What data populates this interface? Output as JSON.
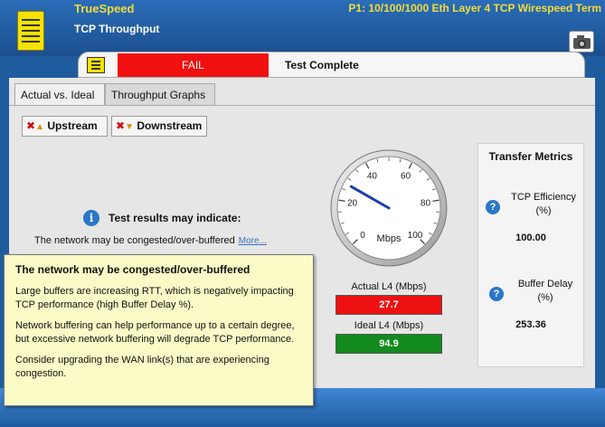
{
  "header": {
    "app_name": "TrueSpeed",
    "test_name": "TCP Throughput",
    "port_info": "P1: 10/100/1000 Eth Layer 4 TCP Wirespeed Term",
    "menu_icon": "menu-icon",
    "camera_icon": "camera-icon"
  },
  "status": {
    "result": "FAIL",
    "result_color": "#f01010",
    "text": "Test Complete"
  },
  "tabs": [
    {
      "label": "Actual vs. Ideal",
      "active": true
    },
    {
      "label": "Throughput Graphs",
      "active": false
    }
  ],
  "direction_buttons": {
    "upstream": "Upstream",
    "downstream": "Downstream"
  },
  "indication": {
    "title": "Test results may indicate:",
    "cause": "The network may be congested/over-buffered",
    "more_link": "More..."
  },
  "gauge": {
    "unit": "Mbps",
    "min": 0,
    "max": 100,
    "ticks": [
      "0",
      "20",
      "40",
      "60",
      "80",
      "100"
    ],
    "needle_value": 27.7
  },
  "actual": {
    "label": "Actual L4 (Mbps)",
    "value": "27.7",
    "color": "#ee1111"
  },
  "ideal": {
    "label": "Ideal L4 (Mbps)",
    "value": "94.9",
    "color": "#128a1e"
  },
  "metrics": {
    "title": "Transfer Metrics",
    "tcp_efficiency": {
      "name_line1": "TCP Efficiency",
      "name_line2": "(%)",
      "value": "100.00"
    },
    "buffer_delay": {
      "name_line1": "Buffer Delay",
      "name_line2": "(%)",
      "value": "253.36"
    }
  },
  "tooltip": {
    "title": "The network may be congested/over-buffered",
    "para1": "Large buffers are increasing RTT, which is negatively impacting TCP performance (high Buffer Delay %).",
    "para2": "Network buffering can help performance up to a certain degree, but excessive network buffering will degrade TCP performance.",
    "para3": "Consider upgrading the WAN link(s) that are experiencing congestion."
  }
}
